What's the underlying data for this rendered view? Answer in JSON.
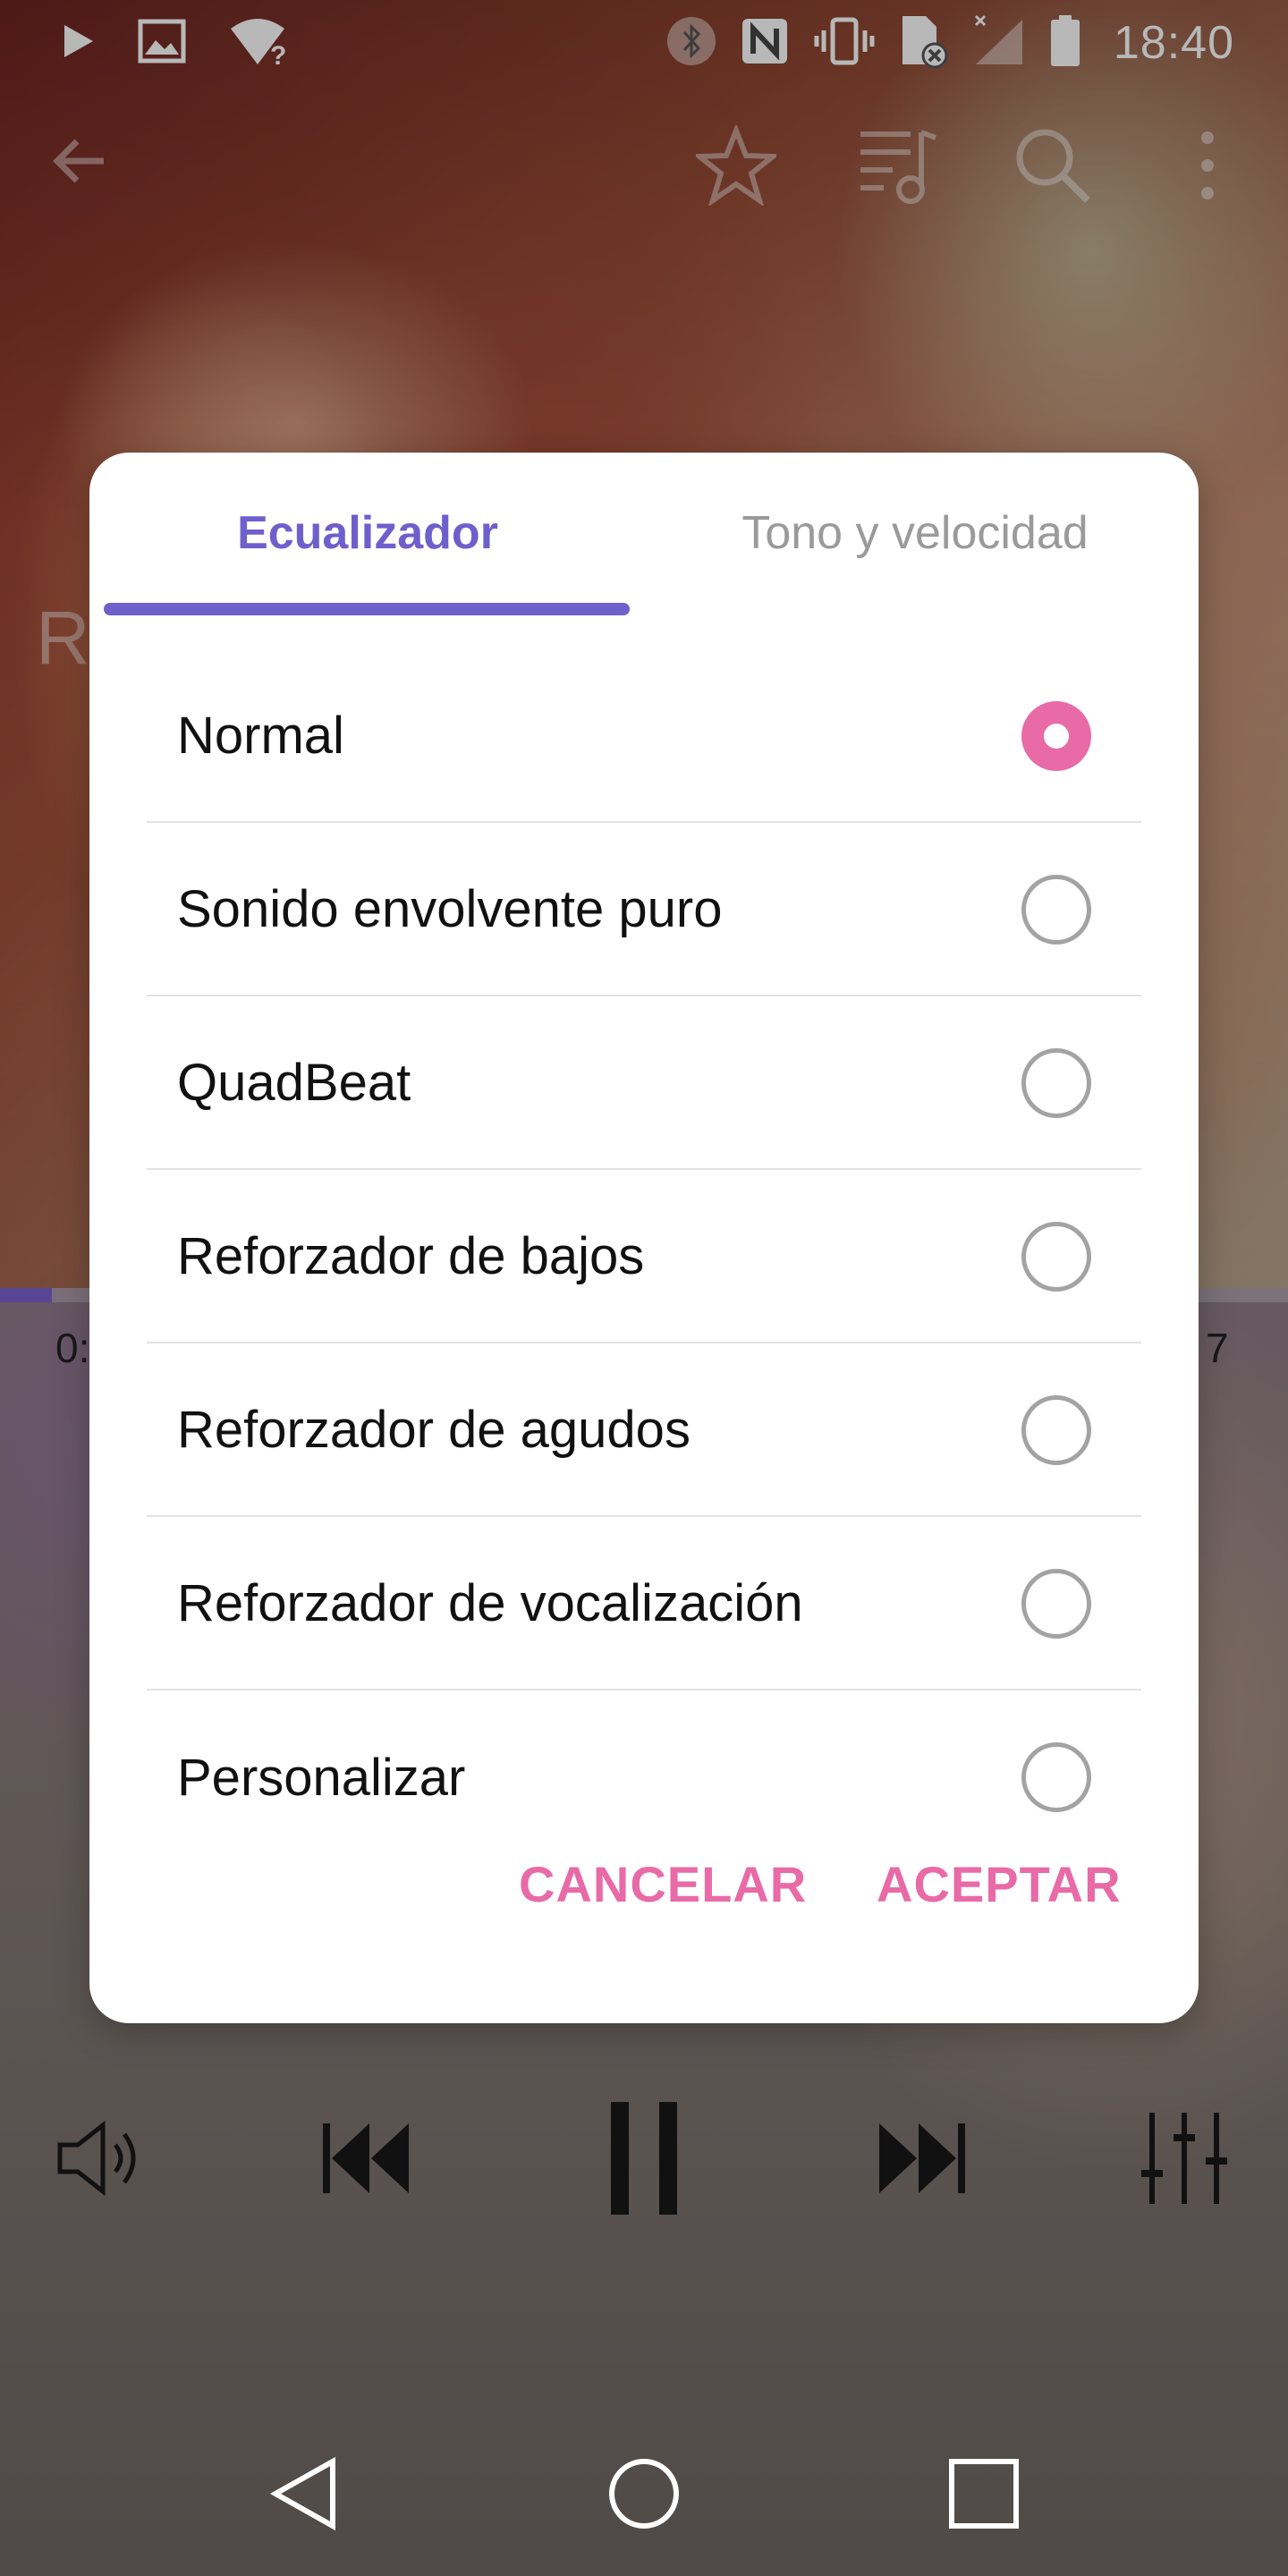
{
  "status_bar": {
    "time": "18:40",
    "icons": [
      "play-icon",
      "image-icon",
      "wifi-question-icon",
      "bluetooth-icon",
      "nfc-icon",
      "vibrate-icon",
      "no-sim-icon",
      "signal-icon",
      "battery-icon"
    ]
  },
  "toolbar": {
    "icons": [
      "back-arrow-icon",
      "star-icon",
      "playlist-icon",
      "search-icon",
      "more-vert-icon"
    ]
  },
  "background_fragments": {
    "left_letter": "R",
    "time_left": "0:",
    "time_right": "7"
  },
  "progress": {
    "fraction": 0.04
  },
  "dialog": {
    "tabs": [
      {
        "label": "Ecualizador",
        "selected": true
      },
      {
        "label": "Tono y velocidad",
        "selected": false
      }
    ],
    "options": [
      {
        "label": "Normal",
        "checked": true
      },
      {
        "label": "Sonido envolvente puro",
        "checked": false
      },
      {
        "label": "QuadBeat",
        "checked": false
      },
      {
        "label": "Reforzador de bajos",
        "checked": false
      },
      {
        "label": "Reforzador de agudos",
        "checked": false
      },
      {
        "label": "Reforzador de vocalización",
        "checked": false
      },
      {
        "label": "Personalizar",
        "checked": false
      }
    ],
    "cancel_label": "CANCELAR",
    "accept_label": "ACEPTAR"
  },
  "controls": {
    "icons": [
      "volume-icon",
      "previous-icon",
      "pause-icon",
      "next-icon",
      "equalizer-icon"
    ]
  },
  "nav_bar": {
    "icons": [
      "nav-back-icon",
      "nav-home-icon",
      "nav-recents-icon"
    ]
  },
  "colors": {
    "accent_purple": "#7060cc",
    "accent_pink": "#e86aa7",
    "inactive_tab": "#9a9a9a"
  }
}
